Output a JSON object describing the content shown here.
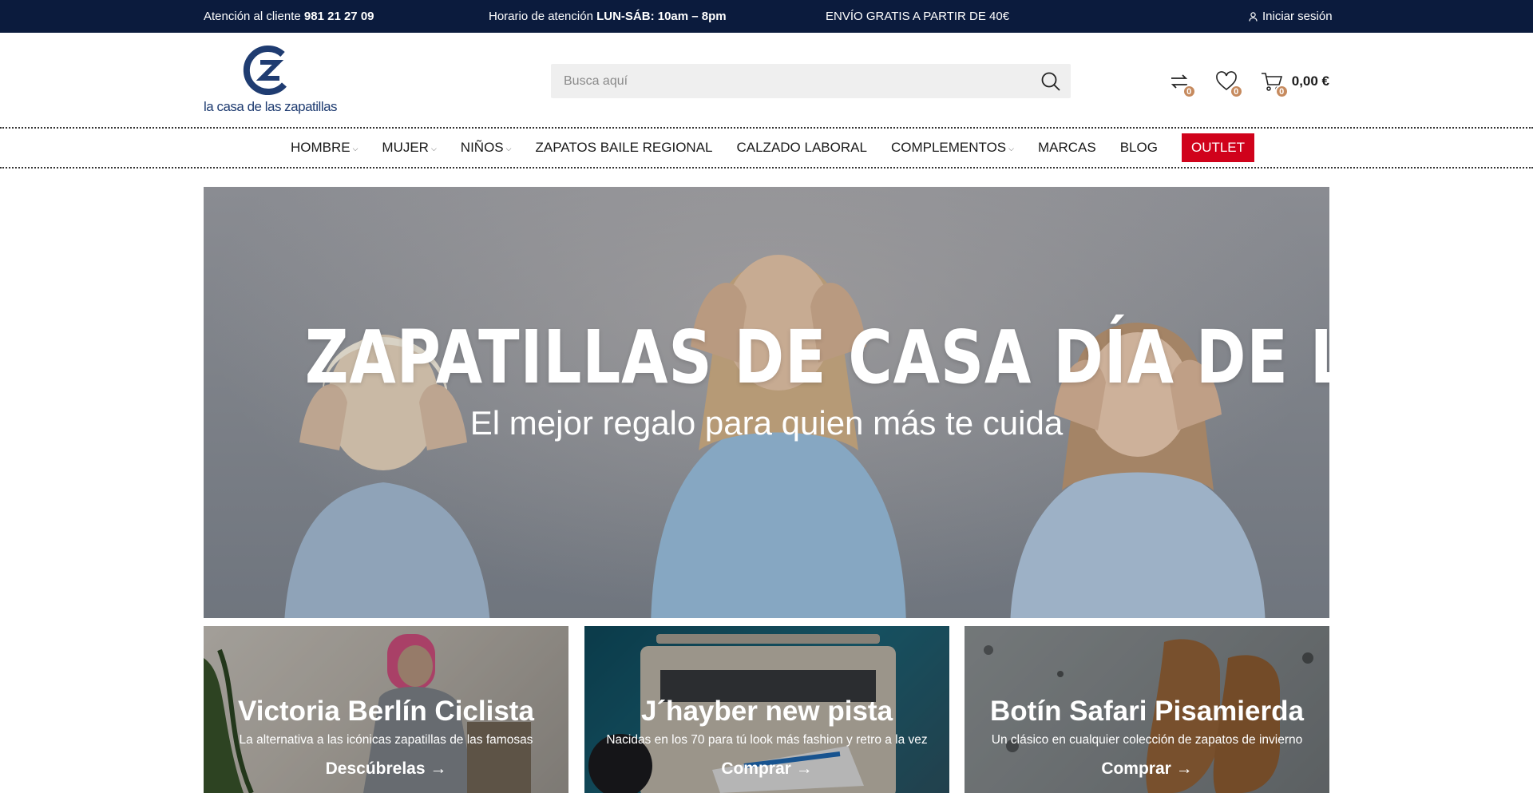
{
  "topbar": {
    "phone_prefix": "Atención al cliente",
    "phone": "981 21 27 09",
    "hours_prefix": "Horario de atención",
    "hours": "LUN-SÁB: 10am – 8pm",
    "shipping": "ENVÍO GRATIS A PARTIR DE 40€",
    "login": "Iniciar sesión"
  },
  "header": {
    "logo_text": "la casa de las zapatillas",
    "search_placeholder": "Busca aquí",
    "compare_count": "0",
    "wishlist_count": "0",
    "cart_count": "0",
    "cart_total": "0,00 €"
  },
  "nav": {
    "items": [
      {
        "label": "HOMBRE",
        "dropdown": true
      },
      {
        "label": "MUJER",
        "dropdown": true
      },
      {
        "label": "NIÑOS",
        "dropdown": true
      },
      {
        "label": "ZAPATOS BAILE REGIONAL",
        "dropdown": false
      },
      {
        "label": "CALZADO LABORAL",
        "dropdown": false
      },
      {
        "label": "COMPLEMENTOS",
        "dropdown": true
      },
      {
        "label": "MARCAS",
        "dropdown": false
      },
      {
        "label": "BLOG",
        "dropdown": false
      },
      {
        "label": "OUTLET",
        "dropdown": false
      }
    ],
    "chevron": "⌵"
  },
  "hero": {
    "title": "ZAPATILLAS DE CASA DÍA DE LA MADRE",
    "subtitle": "El mejor regalo para quien más te cuida"
  },
  "cards": [
    {
      "title": "Victoria Berlín Ciclista",
      "subtitle": "La alternativa a las icónicas zapatillas de las famosas",
      "cta": "Descúbrelas →"
    },
    {
      "title": "J´hayber new pista",
      "subtitle": "Nacidas en los 70 para tú look más fashion y retro a la vez",
      "cta": "Comprar →"
    },
    {
      "title": "Botín Safari Pisamierda",
      "subtitle": "Un clásico en cualquier colección de zapatos de invierno",
      "cta": "Comprar →"
    }
  ],
  "colors": {
    "topbar_bg": "#0b1b3d",
    "brand_blue": "#1f3c71",
    "outlet_red": "#d0021b",
    "badge": "#c68a5e"
  }
}
